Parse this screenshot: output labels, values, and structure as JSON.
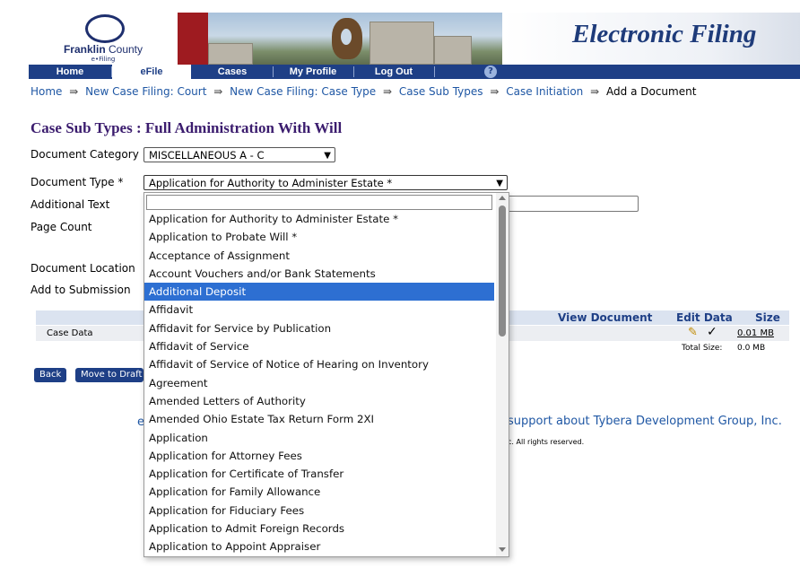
{
  "header": {
    "logo_name_bold": "Franklin",
    "logo_name_rest": " County",
    "logo_sub": "e•Filing",
    "banner_title": "Electronic Filing"
  },
  "nav": {
    "items": [
      "Home",
      "eFile",
      "Cases",
      "My Profile",
      "Log Out"
    ],
    "selected": "eFile",
    "help": "?"
  },
  "breadcrumb": {
    "items": [
      "Home",
      "New Case Filing: Court",
      "New Case Filing: Case Type",
      "Case Sub Types",
      "Case Initiation",
      "Add a Document"
    ],
    "separator": "⇛"
  },
  "page_title": "Case Sub Types : Full Administration With Will",
  "form": {
    "document_category_label": "Document Category",
    "document_category_value": "MISCELLANEOUS A - C",
    "document_type_label": "Document Type *",
    "document_type_value": "Application for Authority to Administer Estate *",
    "additional_text_label": "Additional Text",
    "page_count_label": "Page Count",
    "document_location_label": "Document Location",
    "add_to_submission_label": "Add to Submission"
  },
  "table": {
    "headers": [
      "View Document",
      "Edit Data",
      "Size"
    ],
    "row_label": "Case Data",
    "row_size": "0.01 MB",
    "total_label": "Total Size:",
    "total_value": "0.0 MB"
  },
  "buttons": {
    "back": "Back",
    "move_to_draft": "Move to Draft"
  },
  "footer": {
    "e_text": "e",
    "links": "support   about Tybera Development Group, Inc.",
    "copyright": "c. All rights reserved."
  },
  "dropdown": {
    "options": [
      "Application for Authority to Administer Estate *",
      "Application to Probate Will *",
      "Acceptance of Assignment",
      "Account Vouchers and/or Bank Statements",
      "Additional Deposit",
      "Affidavit",
      "Affidavit for Service by Publication",
      "Affidavit of Service",
      "Affidavit of Service of Notice of Hearing on Inventory",
      "Agreement",
      "Amended Letters of Authority",
      "Amended Ohio Estate Tax Return Form 2XI",
      "Application",
      "Application for Attorney Fees",
      "Application for Certificate of Transfer",
      "Application for Family Allowance",
      "Application for Fiduciary Fees",
      "Application to Admit Foreign Records",
      "Application to Appoint Appraiser"
    ],
    "highlighted_index": 4
  },
  "colors": {
    "nav_bg": "#1e3f86",
    "title": "#3b1c6e",
    "link": "#1f57a4",
    "highlight": "#2d6fd2"
  }
}
